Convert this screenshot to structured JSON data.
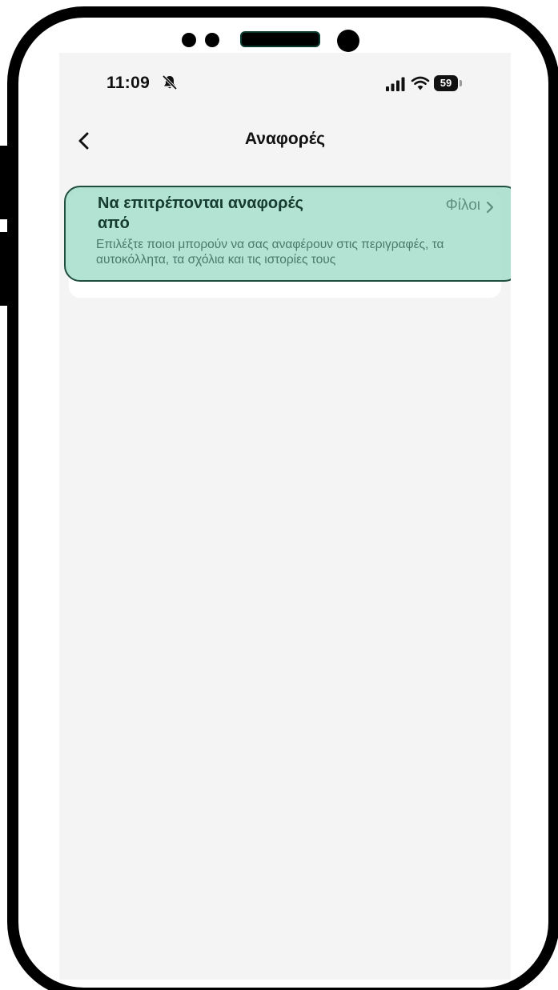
{
  "status_bar": {
    "time": "11:09",
    "battery": "59",
    "icons": [
      "bell-off-icon",
      "signal-icon",
      "wifi-icon",
      "battery-icon"
    ]
  },
  "nav": {
    "title": "Αναφορές",
    "back_icon": "chevron-left-icon"
  },
  "settings": {
    "mentions_row": {
      "title": "Να επιτρέπονται αναφορές από",
      "value": "Φίλοι",
      "description": "Επιλέξτε ποιοι μπορούν να σας αναφέρουν στις περιγραφές, τα αυτοκόλλητα, τα σχόλια και τις ιστορίες τους",
      "icon": "chevron-right-icon"
    }
  },
  "colors": {
    "screen_background": "#f4f4f4",
    "highlight_fill": "#9edbc7",
    "highlight_border": "#1f4d3f",
    "title_text": "#163b30",
    "secondary_text": "#4a7a6b"
  }
}
